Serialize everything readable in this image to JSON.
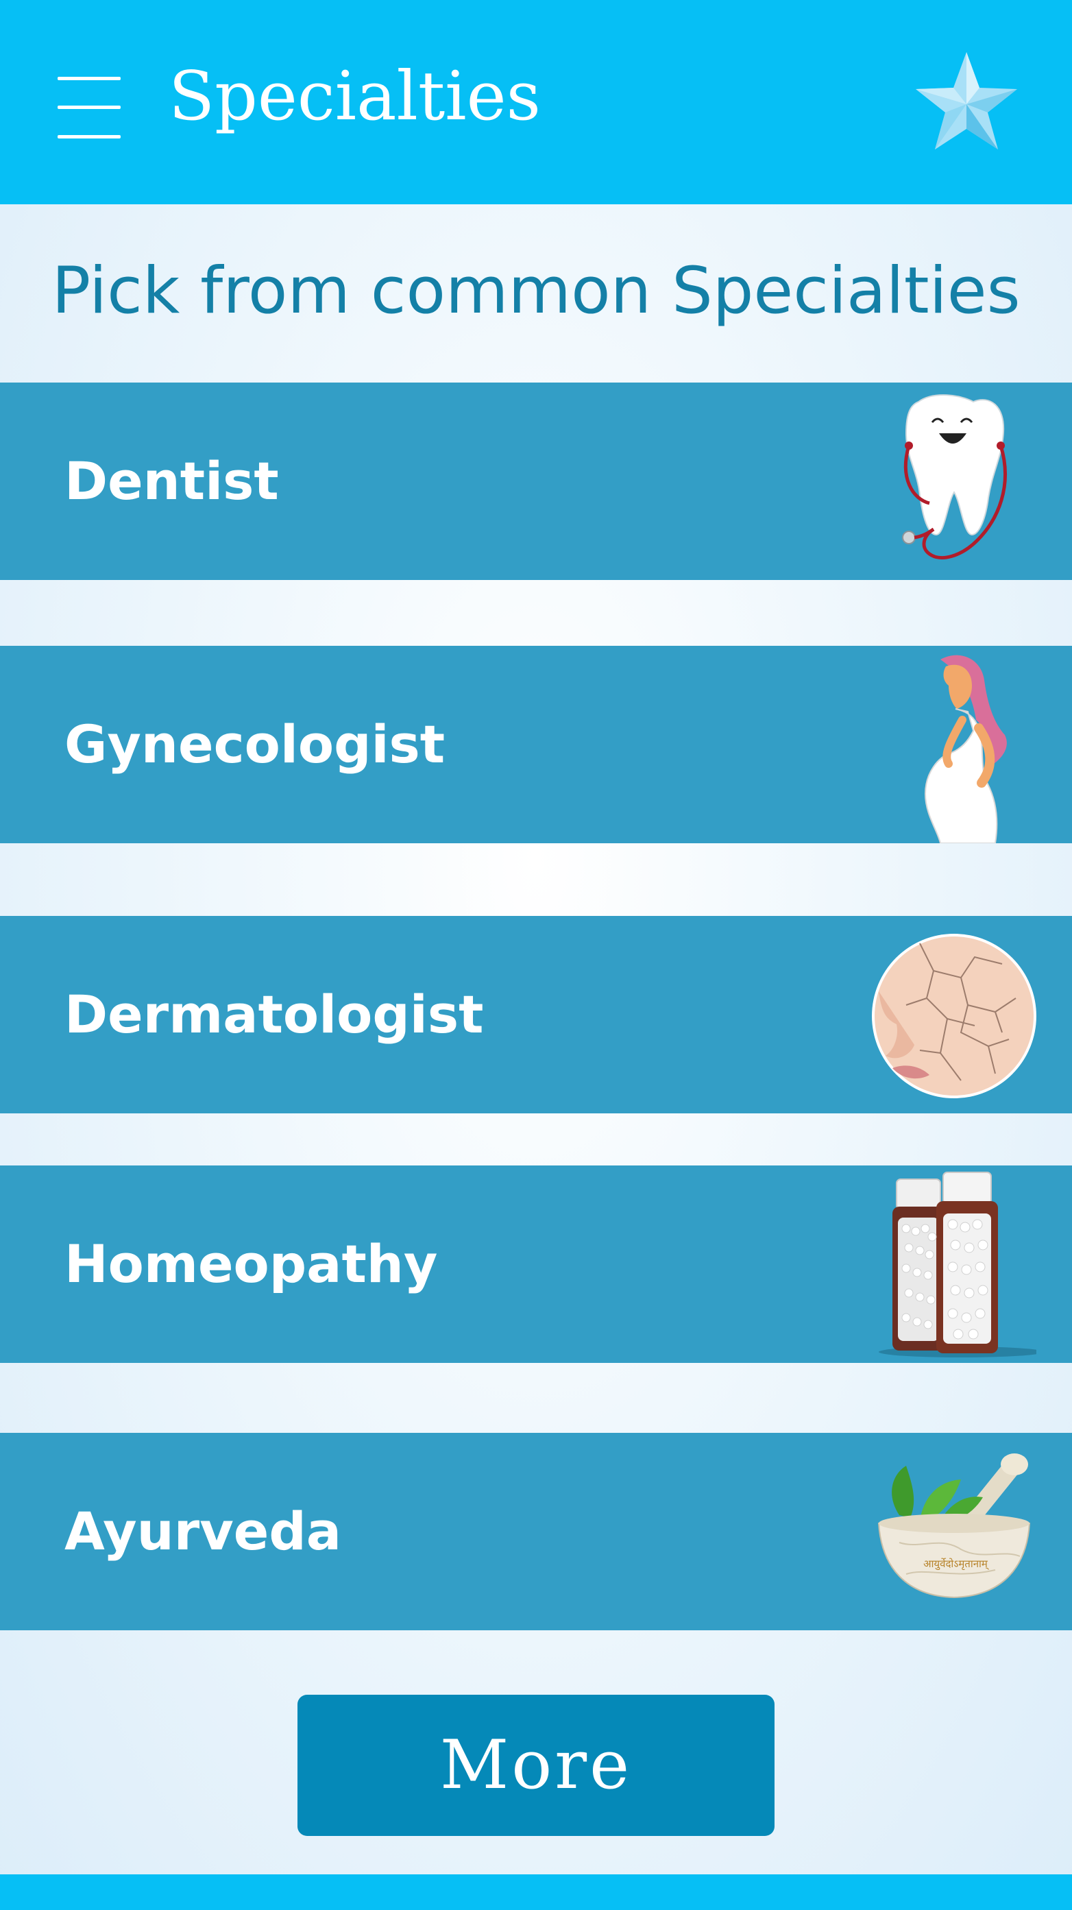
{
  "appbar": {
    "title": "Specialties",
    "menu_icon": "hamburger-menu-icon",
    "favorite_icon": "star-icon",
    "color": "#06bff5"
  },
  "subtitle": "Pick from common Specialties",
  "specialties": [
    {
      "label": "Dentist",
      "icon": "tooth-stethoscope-icon"
    },
    {
      "label": "Gynecologist",
      "icon": "pregnant-woman-icon"
    },
    {
      "label": "Dermatologist",
      "icon": "dry-skin-face-icon"
    },
    {
      "label": "Homeopathy",
      "icon": "homeopathy-pills-icon"
    },
    {
      "label": "Ayurveda",
      "icon": "mortar-pestle-herbs-icon",
      "mortar_text": "आयुर्वेदोऽमृतानाम्"
    }
  ],
  "more_button": {
    "label": "More"
  },
  "colors": {
    "row": "#339ec6",
    "subtitle": "#1480a7",
    "button": "#0589b8"
  }
}
